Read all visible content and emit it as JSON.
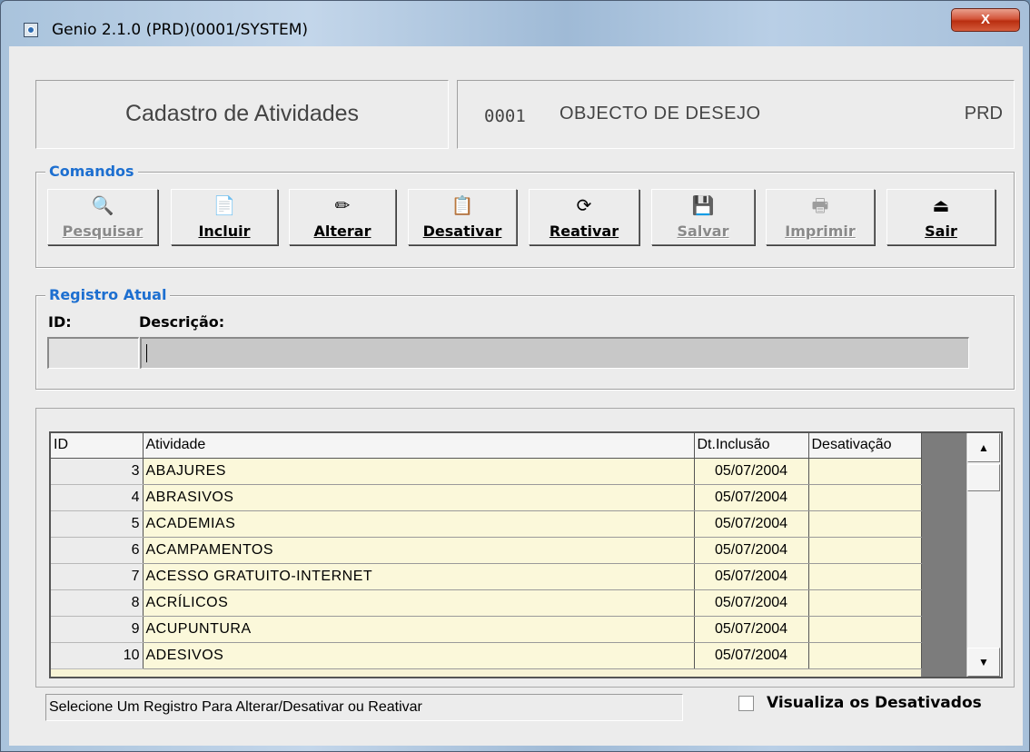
{
  "window": {
    "title": "Genio 2.1.0 (PRD)(0001/SYSTEM)",
    "close_label": "X"
  },
  "header": {
    "title": "Cadastro de Atividades",
    "company_code": "0001",
    "company_name": "OBJECTO DE DESEJO",
    "environment": "PRD"
  },
  "commands": {
    "legend": "Comandos",
    "buttons": [
      {
        "label": "Pesquisar",
        "icon": "binoculars-icon",
        "glyph": "🔍",
        "enabled": false
      },
      {
        "label": "Incluir",
        "icon": "new-document-icon",
        "glyph": "📄",
        "enabled": true
      },
      {
        "label": "Alterar",
        "icon": "pencil-icon",
        "glyph": "✏",
        "enabled": true
      },
      {
        "label": "Desativar",
        "icon": "delete-document-icon",
        "glyph": "📋",
        "enabled": true
      },
      {
        "label": "Reativar",
        "icon": "refresh-icon",
        "glyph": "⟳",
        "enabled": true
      },
      {
        "label": "Salvar",
        "icon": "save-icon",
        "glyph": "💾",
        "enabled": false
      },
      {
        "label": "Imprimir",
        "icon": "printer-icon",
        "glyph": "🖶",
        "enabled": false
      },
      {
        "label": "Sair",
        "icon": "exit-icon",
        "glyph": "⏏",
        "enabled": true
      }
    ]
  },
  "registro": {
    "legend": "Registro Atual",
    "id_label": "ID:",
    "desc_label": "Descrição:",
    "id_value": "",
    "desc_value": ""
  },
  "table": {
    "columns": [
      "ID",
      "Atividade",
      "Dt.Inclusão",
      "Desativação"
    ],
    "rows": [
      {
        "id": "3",
        "atividade": "ABAJURES",
        "dt_inclusao": "05/07/2004",
        "desativacao": ""
      },
      {
        "id": "4",
        "atividade": "ABRASIVOS",
        "dt_inclusao": "05/07/2004",
        "desativacao": ""
      },
      {
        "id": "5",
        "atividade": "ACADEMIAS",
        "dt_inclusao": "05/07/2004",
        "desativacao": ""
      },
      {
        "id": "6",
        "atividade": "ACAMPAMENTOS",
        "dt_inclusao": "05/07/2004",
        "desativacao": ""
      },
      {
        "id": "7",
        "atividade": "ACESSO GRATUITO-INTERNET",
        "dt_inclusao": "05/07/2004",
        "desativacao": ""
      },
      {
        "id": "8",
        "atividade": "ACRÍLICOS",
        "dt_inclusao": "05/07/2004",
        "desativacao": ""
      },
      {
        "id": "9",
        "atividade": "ACUPUNTURA",
        "dt_inclusao": "05/07/2004",
        "desativacao": ""
      },
      {
        "id": "10",
        "atividade": "ADESIVOS",
        "dt_inclusao": "05/07/2004",
        "desativacao": ""
      }
    ]
  },
  "status_text": "Selecione Um Registro Para Alterar/Desativar ou Reativar",
  "checkbox": {
    "label": "Visualiza os Desativados",
    "checked": false
  },
  "colors": {
    "legend": "#1d6fd0",
    "grid_row": "#fbf8da",
    "close_button": "#c7472a"
  }
}
